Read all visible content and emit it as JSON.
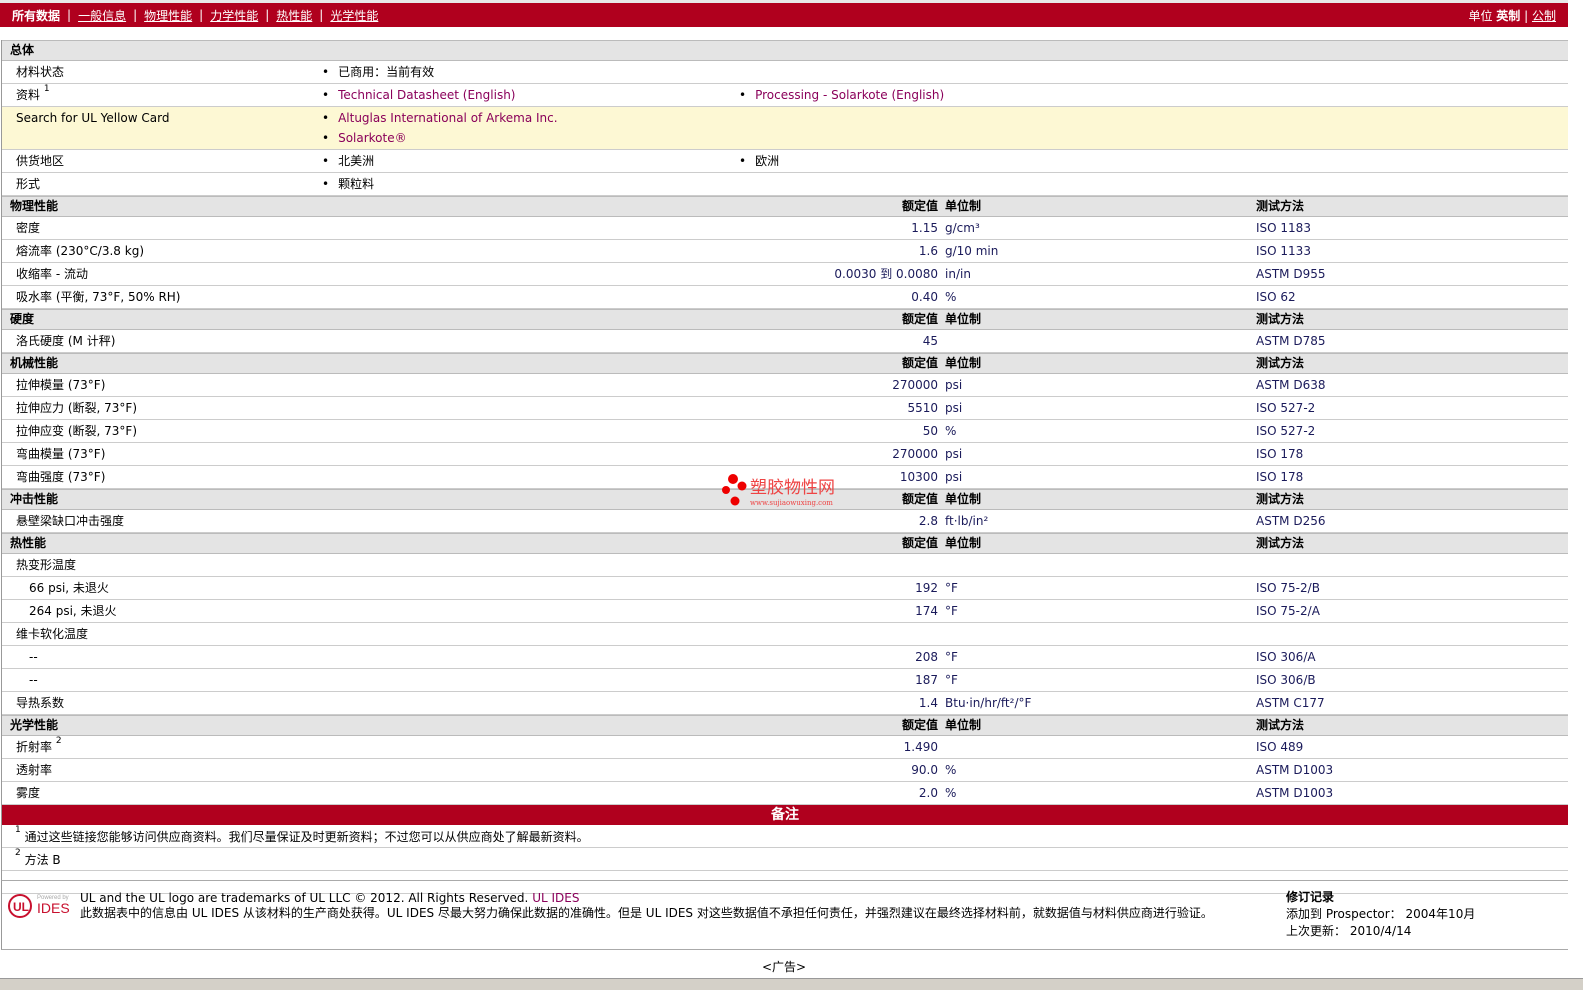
{
  "nav": {
    "items": [
      "所有数据",
      "一般信息",
      "物理性能",
      "力学性能",
      "热性能",
      "光学性能"
    ],
    "current": 0,
    "units_label": "单位",
    "units": [
      "英制",
      "公制"
    ],
    "units_current": 0
  },
  "colors": {
    "brand": "#b0001e",
    "link": "#8a005a",
    "section_bg": "#e4e4e4",
    "highlight_bg": "#fdf8d4"
  },
  "general": {
    "title": "总体",
    "rows": [
      {
        "label": "材料状态",
        "items": [
          "已商用：当前有效"
        ]
      },
      {
        "label": "资料",
        "sup": "1",
        "items": [
          "Technical Datasheet (English)",
          "Processing - Solarkote (English)"
        ],
        "links": true
      },
      {
        "label": "Search for UL Yellow Card",
        "items": [
          "Altuglas International of Arkema Inc.",
          "Solarkote®"
        ],
        "links": true,
        "stacked": true
      },
      {
        "label": "供货地区",
        "items": [
          "北美洲",
          "欧洲"
        ]
      },
      {
        "label": "形式",
        "items": [
          "颗粒料"
        ]
      }
    ]
  },
  "col_headers": {
    "value": "额定值",
    "unit": "单位制",
    "method": "测试方法"
  },
  "sections": [
    {
      "title": "物理性能",
      "rows": [
        {
          "label": "密度",
          "value": "1.15",
          "unit": "g/cm³",
          "method": "ISO 1183"
        },
        {
          "label": "熔流率",
          "cond": "(230°C/3.8 kg)",
          "value": "1.6",
          "unit": "g/10 min",
          "method": "ISO 1133"
        },
        {
          "label": "收缩率",
          "cond": "- 流动",
          "value": "0.0030 到  0.0080",
          "unit": "in/in",
          "method": "ASTM D955"
        },
        {
          "label": "吸水率",
          "cond": "(平衡, 73°F, 50% RH)",
          "value": "0.40",
          "unit": "%",
          "method": "ISO 62"
        }
      ]
    },
    {
      "title": "硬度",
      "rows": [
        {
          "label": "洛氏硬度",
          "cond": "(M 计秤)",
          "value": "45",
          "unit": "",
          "method": "ASTM D785"
        }
      ]
    },
    {
      "title": "机械性能",
      "rows": [
        {
          "label": "拉伸模量",
          "cond": "(73°F)",
          "value": "270000",
          "unit": "psi",
          "method": "ASTM D638"
        },
        {
          "label": "拉伸应力",
          "cond": "(断裂, 73°F)",
          "value": "5510",
          "unit": "psi",
          "method": "ISO 527-2"
        },
        {
          "label": "拉伸应变",
          "cond": "(断裂, 73°F)",
          "value": "50",
          "unit": "%",
          "method": "ISO 527-2"
        },
        {
          "label": "弯曲模量",
          "cond": "(73°F)",
          "value": "270000",
          "unit": "psi",
          "method": "ISO 178"
        },
        {
          "label": "弯曲强度",
          "cond": "(73°F)",
          "value": "10300",
          "unit": "psi",
          "method": "ISO 178"
        }
      ]
    },
    {
      "title": "冲击性能",
      "rows": [
        {
          "label": "悬壁梁缺口冲击强度",
          "value": "2.8",
          "unit": "ft·lb/in²",
          "method": "ASTM D256"
        }
      ]
    },
    {
      "title": "热性能",
      "rows": [
        {
          "label": "热变形温度",
          "value": "",
          "unit": "",
          "method": ""
        },
        {
          "label": "66 psi, 未退火",
          "indent": true,
          "value": "192",
          "unit": "°F",
          "method": "ISO 75-2/B"
        },
        {
          "label": "264 psi, 未退火",
          "indent": true,
          "value": "174",
          "unit": "°F",
          "method": "ISO 75-2/A"
        },
        {
          "label": "维卡软化温度",
          "value": "",
          "unit": "",
          "method": ""
        },
        {
          "label": "--",
          "indent": true,
          "value": "208",
          "unit": "°F",
          "method": "ISO 306/A"
        },
        {
          "label": "--",
          "indent": true,
          "value": "187",
          "unit": "°F",
          "method": "ISO 306/B"
        },
        {
          "label": "导热系数",
          "value": "1.4",
          "unit": "Btu·in/hr/ft²/°F",
          "method": "ASTM C177"
        }
      ]
    },
    {
      "title": "光学性能",
      "rows": [
        {
          "label": "折射率",
          "sup": "2",
          "value": "1.490",
          "unit": "",
          "method": "ISO 489"
        },
        {
          "label": "透射率",
          "value": "90.0",
          "unit": "%",
          "method": "ASTM D1003"
        },
        {
          "label": "雾度",
          "value": "2.0",
          "unit": "%",
          "method": "ASTM D1003"
        }
      ]
    }
  ],
  "notes": {
    "title": "备注",
    "items": [
      {
        "sup": "1",
        "text": "通过这些链接您能够访问供应商资料。我们尽量保证及时更新资料；不过您可以从供应商处了解最新资料。"
      },
      {
        "sup": "2",
        "text": "方法  B"
      }
    ]
  },
  "footer": {
    "logo_text": "Powered by UL IDES",
    "trademark": "UL and the UL logo are trademarks of UL LLC © 2012. All Rights Reserved.",
    "trademark_link": "UL IDES",
    "disclaimer": "此数据表中的信息由  UL IDES 从该材料的生产商处获得。UL IDES 尽最大努力确保此数据的准确性。但是  UL IDES 对这些数据值不承担任何责任，并强烈建议在最终选择材料前，就数据值与材料供应商进行验证。",
    "revision_title": "修订记录",
    "added_label": "添加到  Prospector：",
    "added_value": "2004年10月",
    "updated_label": "上次更新：",
    "updated_value": "2010/4/14"
  },
  "ad": "<广告>",
  "watermark": {
    "text": "塑胶物性网",
    "url": "www.sujiaowuxing.com"
  }
}
